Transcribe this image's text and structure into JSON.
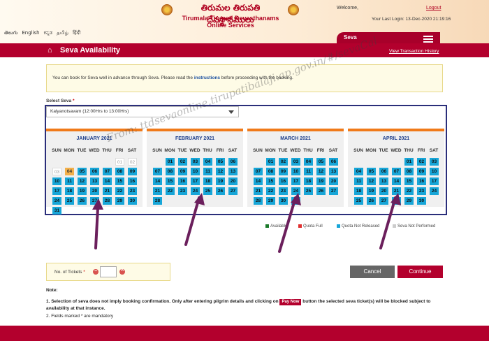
{
  "header": {
    "telugu_title": "తిరుమల తిరుపతి దేవస్థానములు",
    "english_title_1": "Tirumala Tirupati Devasthanams",
    "english_title_2": "Online Services",
    "welcome": "Welcome,",
    "logout": "Logout",
    "last_login": "Your Last Login:  13-Dec-2020 21:19:16",
    "languages": [
      "తెలుగు",
      "English",
      "ಕನ್ನಡ",
      "தமிழ்",
      "हिंदी"
    ],
    "seva_tab": "Seva",
    "menu_icon": "hamburger-icon"
  },
  "titlebar": {
    "home_icon": "home-icon",
    "title": "Seva Availability",
    "view_transaction": "View Transaction History"
  },
  "info": {
    "text_before": "You can book for Seva well in advance through Seva. Please read the ",
    "link": "instructions",
    "text_after": " before proceeding with the booking."
  },
  "seva": {
    "label": "Select Seva",
    "required": "*",
    "selected": "Kalyanotsavam (12:00Hrs to 13:00Hrs)"
  },
  "calendar": {
    "weekdays": [
      "SUN",
      "MON",
      "TUE",
      "WED",
      "THU",
      "FRI",
      "SAT"
    ],
    "months": [
      {
        "name": "JANUARY 2021",
        "start": 5,
        "days": 31,
        "past": [
          1,
          2,
          3
        ],
        "selected": [
          4
        ]
      },
      {
        "name": "FEBRUARY 2021",
        "start": 1,
        "days": 28,
        "past": [],
        "selected": []
      },
      {
        "name": "MARCH 2021",
        "start": 1,
        "days": 31,
        "past": [],
        "selected": []
      },
      {
        "name": "APRIL 2021",
        "start": 4,
        "days": 30,
        "past": [],
        "selected": []
      }
    ]
  },
  "legend": [
    {
      "label": "Available",
      "color": "#1b7a2a"
    },
    {
      "label": "Quota Full",
      "color": "#e03030"
    },
    {
      "label": "Quota Not Released",
      "color": "#17a6d8"
    },
    {
      "label": "Seva Not Performed",
      "color": "#cccccc"
    }
  ],
  "tickets": {
    "label": "No. of Tickets",
    "required": "*",
    "value": ""
  },
  "buttons": {
    "cancel": "Cancel",
    "continue": "Continue"
  },
  "notes": {
    "title": "Note:",
    "note1_before": "1. Selection of seva does not imply booking confirmation. Only after entering pilgrim details and clicking on ",
    "pay_now": "Pay Now",
    "note1_after": " button the selected seva ticket(s) will be blocked subject to availability at that instance.",
    "note2": "2. Fields marked * are mandatory"
  },
  "watermark": "From: ttdsevaonline.tirupatibalaji.ap.gov.in/#/sevaCal"
}
